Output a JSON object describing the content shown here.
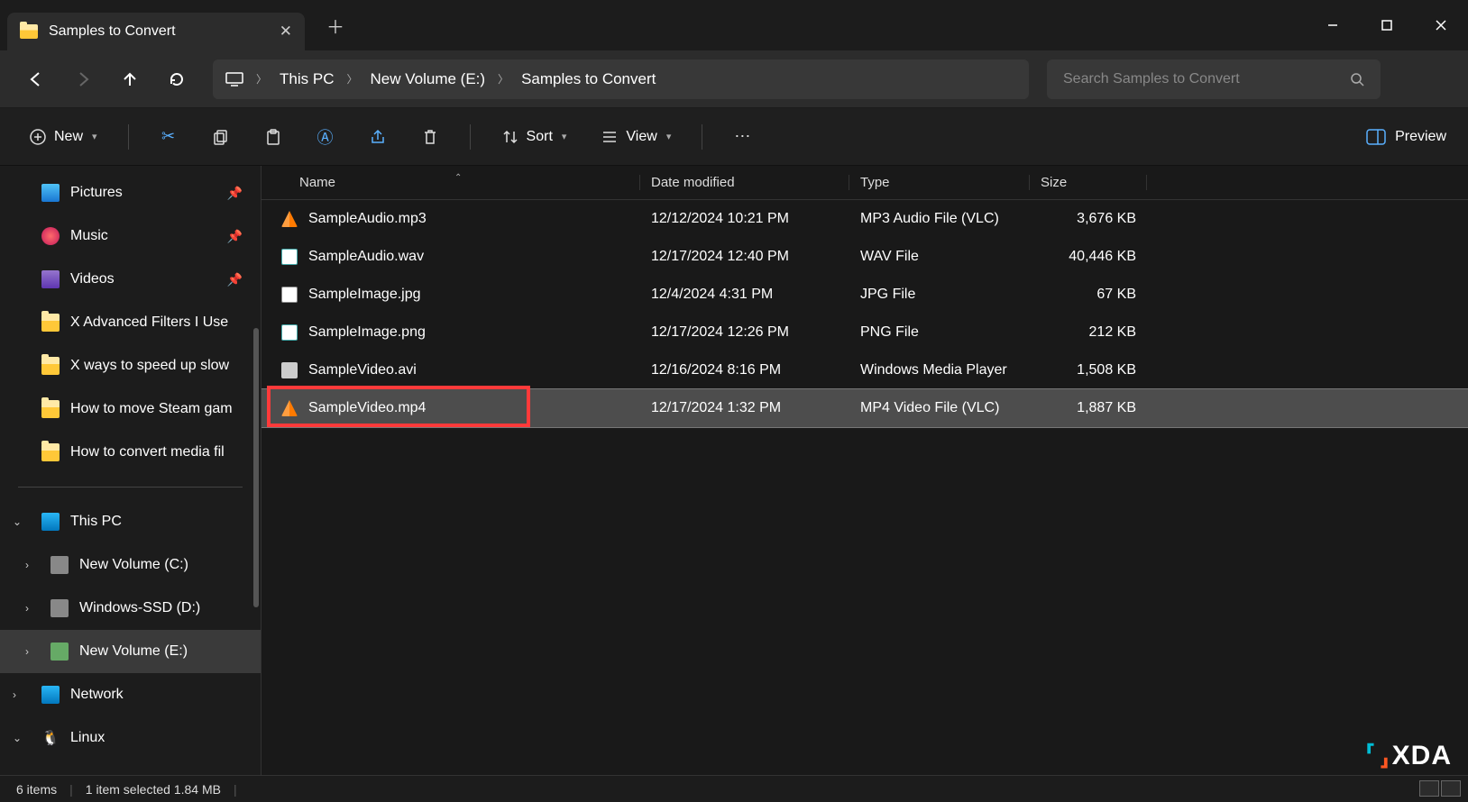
{
  "tab": {
    "title": "Samples to Convert"
  },
  "breadcrumb": {
    "root": "This PC",
    "drive": "New Volume (E:)",
    "folder": "Samples to Convert"
  },
  "search": {
    "placeholder": "Search Samples to Convert"
  },
  "toolbar": {
    "new": "New",
    "sort": "Sort",
    "view": "View",
    "preview": "Preview"
  },
  "sidebar": {
    "pictures": "Pictures",
    "music": "Music",
    "videos": "Videos",
    "folder1": "X Advanced Filters I Use",
    "folder2": "X ways to speed up slow",
    "folder3": "How to move Steam gam",
    "folder4": "How to convert media fil",
    "thispc": "This PC",
    "drive_c": "New Volume (C:)",
    "drive_d": "Windows-SSD (D:)",
    "drive_e": "New Volume (E:)",
    "network": "Network",
    "linux": "Linux"
  },
  "columns": {
    "name": "Name",
    "date": "Date modified",
    "type": "Type",
    "size": "Size"
  },
  "files": [
    {
      "name": "SampleAudio.mp3",
      "date": "12/12/2024 10:21 PM",
      "type": "MP3 Audio File (VLC)",
      "size": "3,676 KB",
      "icon": "vlc"
    },
    {
      "name": "SampleAudio.wav",
      "date": "12/17/2024 12:40 PM",
      "type": "WAV File",
      "size": "40,446 KB",
      "icon": "wav"
    },
    {
      "name": "SampleImage.jpg",
      "date": "12/4/2024 4:31 PM",
      "type": "JPG File",
      "size": "67 KB",
      "icon": "jpg"
    },
    {
      "name": "SampleImage.png",
      "date": "12/17/2024 12:26 PM",
      "type": "PNG File",
      "size": "212 KB",
      "icon": "png"
    },
    {
      "name": "SampleVideo.avi",
      "date": "12/16/2024 8:16 PM",
      "type": "Windows Media Player",
      "size": "1,508 KB",
      "icon": "avi"
    },
    {
      "name": "SampleVideo.mp4",
      "date": "12/17/2024 1:32 PM",
      "type": "MP4 Video File (VLC)",
      "size": "1,887 KB",
      "icon": "vlc",
      "selected": true
    }
  ],
  "status": {
    "count": "6 items",
    "selection": "1 item selected  1.84 MB"
  },
  "watermark": "XDA"
}
